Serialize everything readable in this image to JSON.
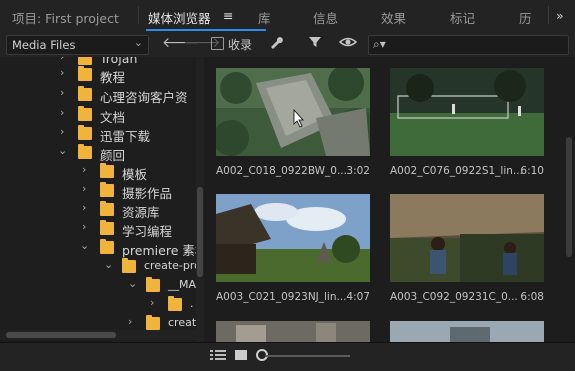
{
  "tabs": {
    "project": "项目: First project",
    "media_browser": "媒体浏览器",
    "media_browser_menu": "≡",
    "library": "库",
    "info": "信息",
    "effects": "效果",
    "markers": "标记",
    "history": "历",
    "overflow": "»"
  },
  "toolbar": {
    "media_files": "Media Files",
    "collect_label": "收录",
    "search_value": ""
  },
  "tree": {
    "rows": [
      {
        "name": "Trojan"
      },
      {
        "name": "教程"
      },
      {
        "name": "心理咨询客户资"
      },
      {
        "name": "文档"
      },
      {
        "name": "迅雷下载"
      },
      {
        "name": "颜回"
      },
      {
        "name": "模板"
      },
      {
        "name": "摄影作品"
      },
      {
        "name": "资源库"
      },
      {
        "name": "学习编程"
      },
      {
        "name": "premiere 素材"
      },
      {
        "name": "create-pro"
      },
      {
        "name": "__MA"
      },
      {
        "name": "."
      },
      {
        "name": "creat"
      }
    ]
  },
  "clips": [
    {
      "name": "A002_C018_0922BW_0...",
      "duration": "3:02"
    },
    {
      "name": "A002_C076_0922S1_lin...",
      "duration": "6:10"
    },
    {
      "name": "A003_C021_0923NJ_lin...",
      "duration": "4:07"
    },
    {
      "name": "A003_C092_09231C_0...",
      "duration": "6:08"
    }
  ]
}
